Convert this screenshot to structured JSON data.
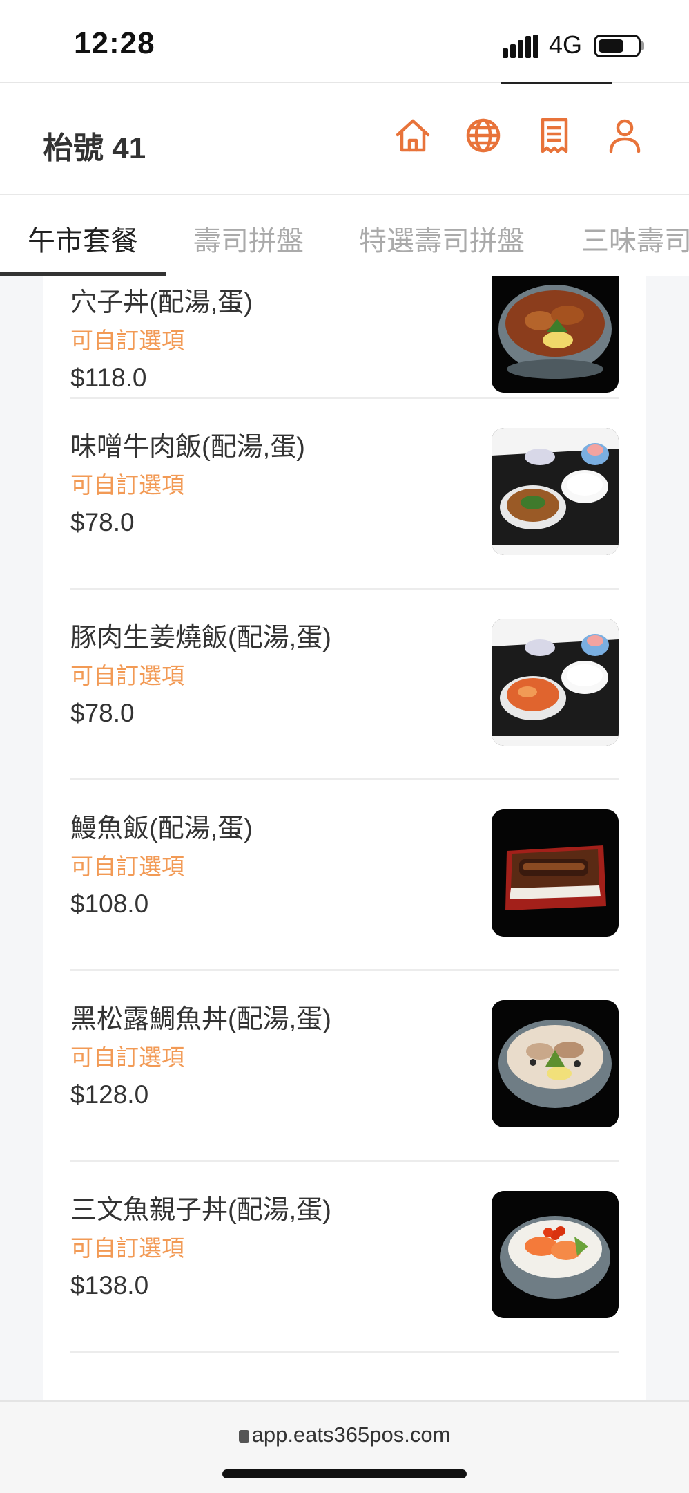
{
  "status_bar": {
    "time": "12:28",
    "network": "4G"
  },
  "header": {
    "title": "枱號 41",
    "icons": [
      "home-icon",
      "globe-icon",
      "receipt-icon",
      "user-icon"
    ],
    "accent_color": "#e8733a"
  },
  "tabs": [
    {
      "label": "午市套餐",
      "active": true
    },
    {
      "label": "壽司拼盤",
      "active": false
    },
    {
      "label": "特選壽司拼盤",
      "active": false
    },
    {
      "label": "三味壽司",
      "active": false
    }
  ],
  "menu_items": [
    {
      "name": "穴子丼(配湯,蛋)",
      "option": "可自訂選項",
      "price": "$118.0",
      "image": "bowl-anago"
    },
    {
      "name": "味噌牛肉飯(配湯,蛋)",
      "option": "可自訂選項",
      "price": "$78.0",
      "image": "tray-beef"
    },
    {
      "name": "豚肉生姜燒飯(配湯,蛋)",
      "option": "可自訂選項",
      "price": "$78.0",
      "image": "tray-pork"
    },
    {
      "name": "鰻魚飯(配湯,蛋)",
      "option": "可自訂選項",
      "price": "$108.0",
      "image": "box-eel"
    },
    {
      "name": "黑松露鯛魚丼(配湯,蛋)",
      "option": "可自訂選項",
      "price": "$128.0",
      "image": "bowl-snapper"
    },
    {
      "name": "三文魚親子丼(配湯,蛋)",
      "option": "可自訂選項",
      "price": "$138.0",
      "image": "bowl-salmon"
    }
  ],
  "browser": {
    "url": "app.eats365pos.com"
  }
}
